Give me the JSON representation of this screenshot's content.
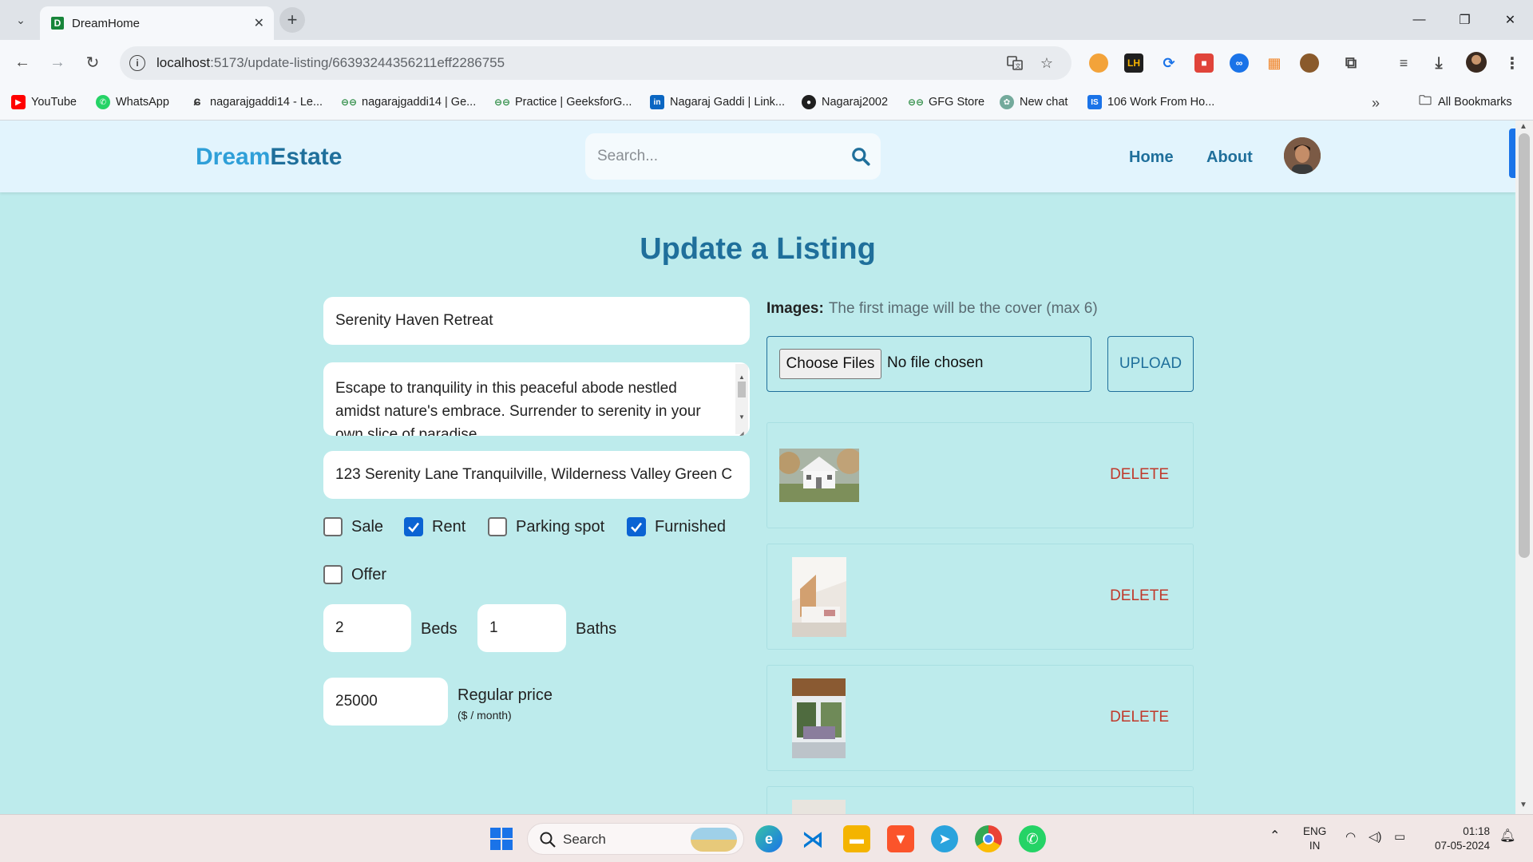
{
  "browser": {
    "tab_title": "DreamHome",
    "tab_favicon": "D",
    "url_host": "localhost",
    "url_path": ":5173/update-listing/66393244356211eff2286755",
    "bookmarks": [
      {
        "label": "YouTube",
        "icon": "youtube-icon",
        "color": "#ff0000"
      },
      {
        "label": "WhatsApp",
        "icon": "whatsapp-icon",
        "color": "#25d366"
      },
      {
        "label": "nagarajgaddi14 - Le...",
        "icon": "leetcode-icon",
        "color": "#f0a020"
      },
      {
        "label": "nagarajgaddi14 | Ge...",
        "icon": "gfg-icon",
        "color": "#2f8d46"
      },
      {
        "label": "Practice | GeeksforG...",
        "icon": "gfg-icon",
        "color": "#2f8d46"
      },
      {
        "label": "Nagaraj Gaddi | Link...",
        "icon": "linkedin-icon",
        "color": "#0a66c2"
      },
      {
        "label": "Nagaraj2002",
        "icon": "github-icon",
        "color": "#1f1f1f"
      },
      {
        "label": "GFG Store",
        "icon": "gfg-icon",
        "color": "#2f8d46"
      },
      {
        "label": "New chat",
        "icon": "chatgpt-icon",
        "color": "#74aa9c"
      },
      {
        "label": "106 Work From Ho...",
        "icon": "is-icon",
        "color": "#1a73e8"
      }
    ],
    "all_bookmarks": "All Bookmarks"
  },
  "site": {
    "logo_part1": "Dream",
    "logo_part2": "Estate",
    "search_placeholder": "Search...",
    "nav": {
      "home": "Home",
      "about": "About"
    }
  },
  "form": {
    "title": "Update a Listing",
    "name": "Serenity Haven Retreat",
    "description": " Escape to tranquility in this peaceful abode nestled amidst nature's embrace. Surrender to serenity in your own slice of paradise.",
    "address": "123 Serenity Lane Tranquilville, Wilderness Valley Green C",
    "checkboxes": {
      "sale": {
        "label": "Sale",
        "checked": false
      },
      "rent": {
        "label": "Rent",
        "checked": true
      },
      "parking": {
        "label": "Parking spot",
        "checked": false
      },
      "furnished": {
        "label": "Furnished",
        "checked": true
      },
      "offer": {
        "label": "Offer",
        "checked": false
      }
    },
    "beds": "2",
    "beds_label": "Beds",
    "baths": "1",
    "baths_label": "Baths",
    "regular_price": "25000",
    "regular_price_label": "Regular price",
    "regular_price_unit": "($ / month)"
  },
  "images": {
    "label": "Images:",
    "hint": "The first image will be the cover (max 6)",
    "choose_files": "Choose Files",
    "no_file": "No file chosen",
    "upload": "UPLOAD",
    "delete_label": "DELETE",
    "items": [
      "house-exterior-image",
      "bedroom-image",
      "porch-image"
    ]
  },
  "taskbar": {
    "search": "Search",
    "lang1": "ENG",
    "lang2": "IN",
    "time": "01:18",
    "date": "07-05-2024"
  }
}
